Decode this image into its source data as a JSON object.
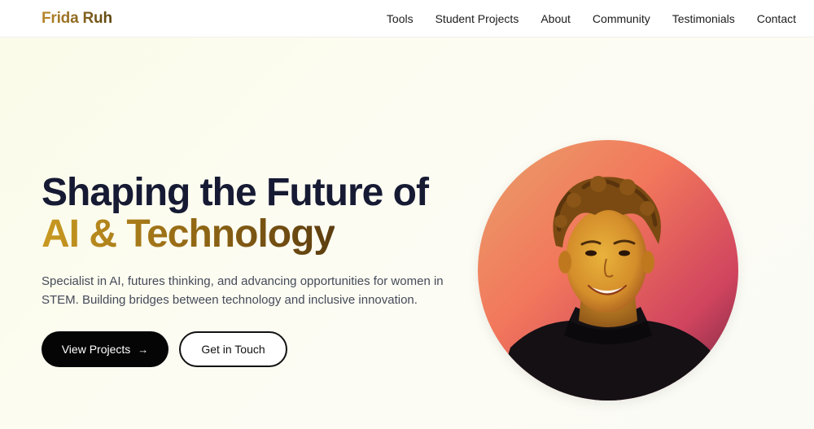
{
  "brand": {
    "name": "Frida Ruh"
  },
  "nav": {
    "items": [
      {
        "label": "Tools"
      },
      {
        "label": "Student Projects"
      },
      {
        "label": "About"
      },
      {
        "label": "Community"
      },
      {
        "label": "Testimonials"
      },
      {
        "label": "Contact"
      }
    ]
  },
  "hero": {
    "headline_line1": "Shaping the Future of",
    "headline_line2": "AI & Technology",
    "subtitle": "Specialist in AI, futures thinking, and advancing opportunities for women in STEM. Building bridges between technology and inclusive innovation.",
    "primary_button": {
      "label": "View Projects",
      "icon": "arrow-right-icon",
      "glyph": "→"
    },
    "secondary_button": {
      "label": "Get in Touch"
    },
    "portrait": {
      "description_icon": "portrait-photo"
    }
  },
  "colors": {
    "brand_gold": "#a5791f",
    "headline_navy": "#161a33",
    "primary_button_bg": "#050505",
    "background": "#fcfcf3"
  }
}
